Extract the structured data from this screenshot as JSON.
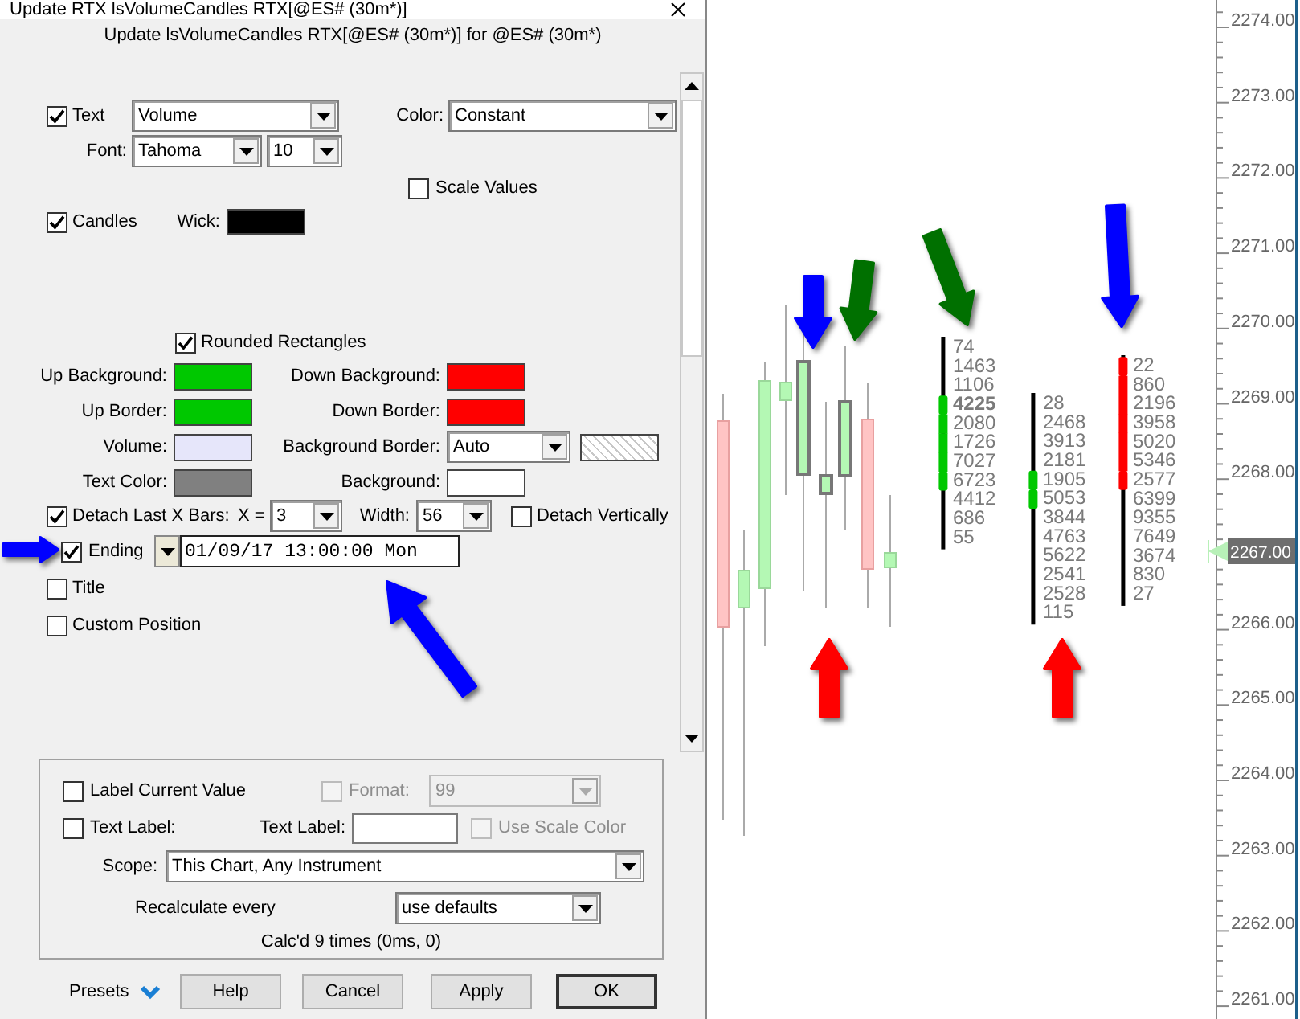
{
  "window": {
    "title": "Update RTX lsVolumeCandles RTX[@ES# (30m*)]"
  },
  "header": "Update lsVolumeCandles RTX[@ES# (30m*)] for @ES# (30m*)",
  "text_option": {
    "label": "Text",
    "checked": true,
    "value": "Volume"
  },
  "color": {
    "label": "Color:",
    "value": "Constant"
  },
  "font": {
    "label": "Font:",
    "value": "Tahoma",
    "size": "10"
  },
  "scale_values": {
    "label": "Scale Values",
    "checked": false
  },
  "candles": {
    "label": "Candles",
    "checked": true
  },
  "wick": {
    "label": "Wick:",
    "color": "#000000"
  },
  "rounded_rectangles": {
    "label": "Rounded Rectangles",
    "checked": true
  },
  "color_settings": [
    {
      "kind": "swatch",
      "label": "Up Background:",
      "color": "#00c800"
    },
    {
      "kind": "swatch",
      "label": "Down Background:",
      "color": "#ff0000"
    },
    {
      "kind": "swatch",
      "label": "Up Border:",
      "color": "#00c800"
    },
    {
      "kind": "swatch",
      "label": "Down Border:",
      "color": "#ff0000"
    },
    {
      "kind": "swatch",
      "label": "Volume:",
      "color": "#e6e6fa"
    },
    {
      "kind": "dropdown",
      "label": "Background Border:",
      "value": "Auto"
    },
    {
      "kind": "swatch",
      "label": "Text Color:",
      "color": "#808080"
    },
    {
      "kind": "swatch",
      "label": "Background:",
      "color": "#ffffff"
    }
  ],
  "detach": {
    "label": "Detach Last X Bars:",
    "checked": true,
    "x_label": "X =",
    "x_value": "3",
    "width_label": "Width:",
    "width_value": "56"
  },
  "detach_vertically": {
    "label": "Detach Vertically",
    "checked": false
  },
  "ending": {
    "label": "Ending",
    "checked": true,
    "value": "01/09/17 13:00:00 Mon"
  },
  "title_option": {
    "label": "Title",
    "checked": false
  },
  "custom_position": {
    "label": "Custom Position",
    "checked": false
  },
  "label_group": {
    "label_current_value": {
      "label": "Label Current Value",
      "checked": false
    },
    "format": {
      "label": "Format:",
      "checked": false,
      "disabled": true,
      "value": "99"
    },
    "text_label_check": {
      "label": "Text Label:",
      "checked": false
    },
    "text_label_field": {
      "label": "Text Label:"
    },
    "use_scale_color": {
      "label": "Use Scale Color",
      "checked": false,
      "disabled": true
    },
    "scope": {
      "label": "Scope:",
      "value": "This Chart, Any Instrument"
    },
    "recalculate": {
      "label": "Recalculate every",
      "value": "use defaults"
    },
    "status": "Calc'd 9 times (0ms, 0)"
  },
  "buttons": {
    "presets": "Presets",
    "actions": [
      "Help",
      "Cancel",
      "Apply",
      "OK"
    ]
  },
  "chart": {
    "price_labels": [
      "2274.00",
      "2273.00",
      "2272.00",
      "2271.00",
      "2270.00",
      "2269.00",
      "2268.00",
      "2266.00",
      "2265.00",
      "2264.00",
      "2263.00",
      "2262.00",
      "2261.00"
    ],
    "current_price": "2267.00",
    "ladders": [
      {
        "color": "#00c800",
        "rows": [
          {
            "value": "74",
            "bold": false,
            "in_body": false
          },
          {
            "value": "1463",
            "bold": false,
            "in_body": false
          },
          {
            "value": "1106",
            "bold": false,
            "in_body": false
          },
          {
            "value": "4225",
            "bold": true,
            "in_body": true
          },
          {
            "value": "2080",
            "bold": false,
            "in_body": true
          },
          {
            "value": "1726",
            "bold": false,
            "in_body": true
          },
          {
            "value": "7027",
            "bold": false,
            "in_body": true
          },
          {
            "value": "6723",
            "bold": false,
            "in_body": true
          },
          {
            "value": "4412",
            "bold": false,
            "in_body": false
          },
          {
            "value": "686",
            "bold": false,
            "in_body": false
          },
          {
            "value": "55",
            "bold": false,
            "in_body": false
          }
        ]
      },
      {
        "color": "#00c800",
        "rows": [
          {
            "value": "28",
            "bold": false,
            "in_body": false
          },
          {
            "value": "2468",
            "bold": false,
            "in_body": false
          },
          {
            "value": "3913",
            "bold": false,
            "in_body": false
          },
          {
            "value": "2181",
            "bold": false,
            "in_body": false
          },
          {
            "value": "1905",
            "bold": false,
            "in_body": true
          },
          {
            "value": "5053",
            "bold": false,
            "in_body": true
          },
          {
            "value": "3844",
            "bold": false,
            "in_body": false
          },
          {
            "value": "4763",
            "bold": false,
            "in_body": false
          },
          {
            "value": "5622",
            "bold": false,
            "in_body": false
          },
          {
            "value": "2541",
            "bold": false,
            "in_body": false
          },
          {
            "value": "2528",
            "bold": false,
            "in_body": false
          },
          {
            "value": "115",
            "bold": false,
            "in_body": false
          }
        ]
      },
      {
        "color": "#ff0000",
        "rows": [
          {
            "value": "22",
            "bold": false,
            "in_body": true
          },
          {
            "value": "860",
            "bold": false,
            "in_body": true
          },
          {
            "value": "2196",
            "bold": false,
            "in_body": true
          },
          {
            "value": "3958",
            "bold": false,
            "in_body": true
          },
          {
            "value": "5020",
            "bold": false,
            "in_body": true
          },
          {
            "value": "5346",
            "bold": false,
            "in_body": true
          },
          {
            "value": "2577",
            "bold": false,
            "in_body": true
          },
          {
            "value": "6399",
            "bold": false,
            "in_body": false
          },
          {
            "value": "9355",
            "bold": false,
            "in_body": false
          },
          {
            "value": "7649",
            "bold": false,
            "in_body": false
          },
          {
            "value": "3674",
            "bold": false,
            "in_body": false
          },
          {
            "value": "830",
            "bold": false,
            "in_body": false
          },
          {
            "value": "27",
            "bold": false,
            "in_body": false
          }
        ]
      }
    ]
  },
  "annotation_arrows": [
    {
      "color": "#0000ff"
    },
    {
      "color": "#0000ff"
    },
    {
      "color": "#0000ff"
    },
    {
      "color": "#007000"
    },
    {
      "color": "#007000"
    },
    {
      "color": "#0000ff"
    },
    {
      "color": "#ff0000"
    },
    {
      "color": "#ff0000"
    }
  ]
}
